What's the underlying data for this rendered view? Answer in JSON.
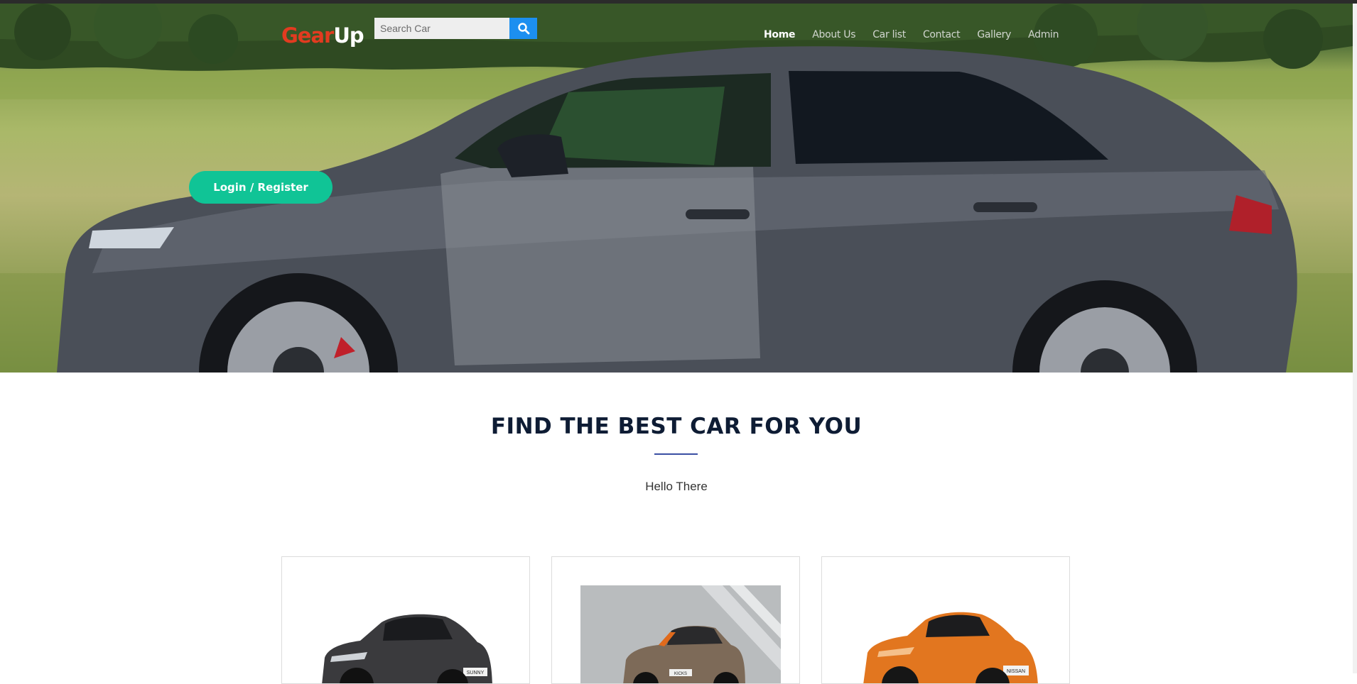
{
  "brand": {
    "part1": "Gear",
    "part2": "Up",
    "part1_color": "#e23b20",
    "part2_color": "#ffffff"
  },
  "search": {
    "placeholder": "Search Car",
    "button_icon": "search-icon",
    "button_color": "#1c8ff0"
  },
  "nav": {
    "items": [
      {
        "label": "Home",
        "active": true
      },
      {
        "label": "About Us",
        "active": false
      },
      {
        "label": "Car list",
        "active": false
      },
      {
        "label": "Contact",
        "active": false
      },
      {
        "label": "Gallery",
        "active": false
      },
      {
        "label": "Admin",
        "active": false
      }
    ]
  },
  "hero": {
    "cta_label": "Login / Register",
    "cta_color": "#10c496"
  },
  "section": {
    "title": "FIND THE BEST CAR FOR YOU",
    "subtitle": "Hello There",
    "accent_color": "#3a4fa3"
  },
  "cars": [
    {
      "image": "dark-grey-sedan",
      "plate": "SUNNY"
    },
    {
      "image": "bronze-crossover-suv",
      "plate": "KICKS"
    },
    {
      "image": "orange-sports-coupe",
      "plate": "NISSAN"
    }
  ]
}
